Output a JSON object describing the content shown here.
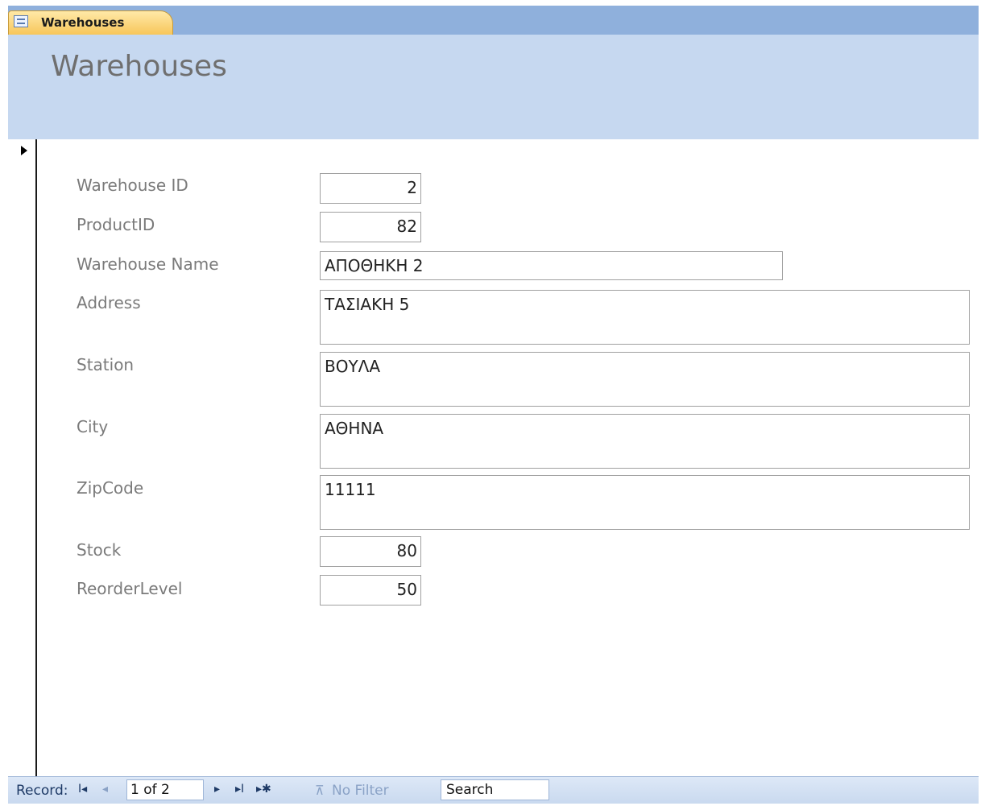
{
  "tab": {
    "label": "Warehouses",
    "icon": "form-icon"
  },
  "header": {
    "title": "Warehouses"
  },
  "fields": {
    "warehouse_id": {
      "label": "Warehouse ID",
      "value": "2"
    },
    "product_id": {
      "label": "ProductID",
      "value": "82"
    },
    "warehouse_name": {
      "label": "Warehouse Name",
      "value": "ΑΠΟΘΗΚΗ 2"
    },
    "address": {
      "label": "Address",
      "value": "ΤΑΣΙΑΚΗ 5"
    },
    "station": {
      "label": "Station",
      "value": "ΒΟΥΛΑ"
    },
    "city": {
      "label": "City",
      "value": "ΑΘΗΝΑ"
    },
    "zipcode": {
      "label": "ZipCode",
      "value": "11111"
    },
    "stock": {
      "label": "Stock",
      "value": "80"
    },
    "reorder_level": {
      "label": "ReorderLevel",
      "value": "50"
    }
  },
  "navigation": {
    "record_label": "Record:",
    "first_symbol": "I◂",
    "prev_symbol": "◂",
    "counter": "1 of 2",
    "next_symbol": "▸",
    "last_symbol": "▸I",
    "new_symbol": "▸✱",
    "filter_label": "No Filter",
    "search_text": "Search"
  }
}
